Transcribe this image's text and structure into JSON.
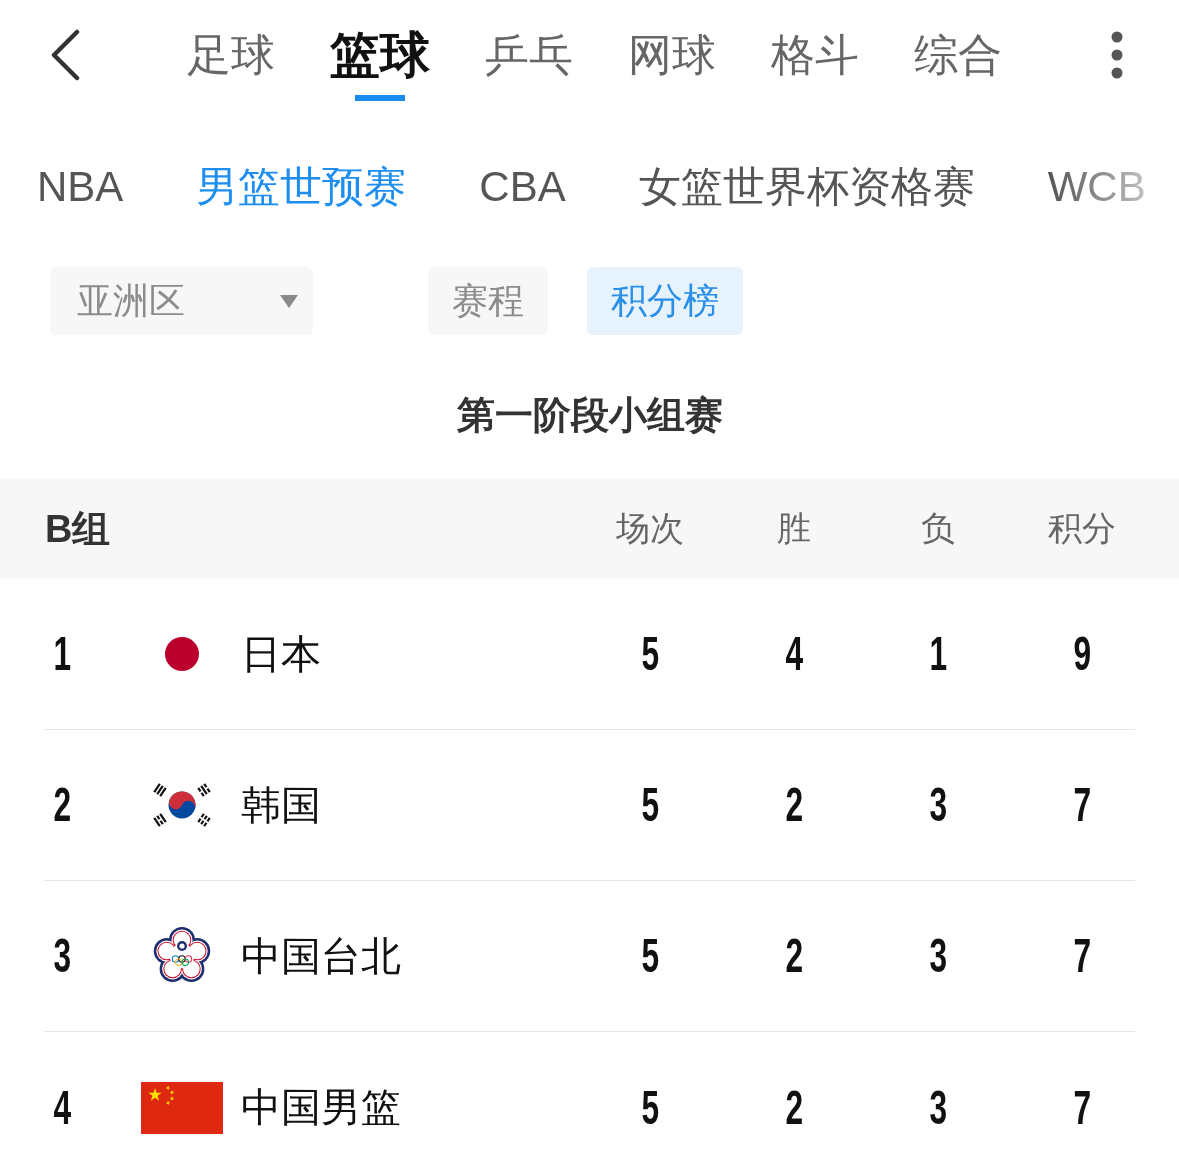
{
  "nav": {
    "sport_tabs": [
      {
        "label": "足球",
        "selected": false
      },
      {
        "label": "篮球",
        "selected": true
      },
      {
        "label": "乒乓",
        "selected": false
      },
      {
        "label": "网球",
        "selected": false
      },
      {
        "label": "格斗",
        "selected": false
      },
      {
        "label": "综合",
        "selected": false
      }
    ]
  },
  "league_tabs": [
    {
      "label": "NBA",
      "selected": false
    },
    {
      "label": "男篮世预赛",
      "selected": true
    },
    {
      "label": "CBA",
      "selected": false
    },
    {
      "label": "女篮世界杯资格赛",
      "selected": false
    },
    {
      "label": "WCB",
      "selected": false
    }
  ],
  "filters": {
    "region": "亚洲区",
    "view_tabs": [
      {
        "label": "赛程",
        "selected": false
      },
      {
        "label": "积分榜",
        "selected": true
      }
    ]
  },
  "stage_title": "第一阶段小组赛",
  "standings": {
    "group": "B组",
    "columns": [
      "场次",
      "胜",
      "负",
      "积分"
    ],
    "rows": [
      {
        "rank": "1",
        "kind": "disc",
        "team": "日本",
        "played": "5",
        "won": "4",
        "lost": "1",
        "points": "9"
      },
      {
        "rank": "2",
        "kind": "taegeuk",
        "team": "韩国",
        "played": "5",
        "won": "2",
        "lost": "3",
        "points": "7"
      },
      {
        "rank": "3",
        "kind": "blossom",
        "team": "中国台北",
        "played": "5",
        "won": "2",
        "lost": "3",
        "points": "7"
      },
      {
        "rank": "4",
        "kind": "stars",
        "team": "中国男篮",
        "played": "5",
        "won": "2",
        "lost": "3",
        "points": "7"
      }
    ]
  }
}
